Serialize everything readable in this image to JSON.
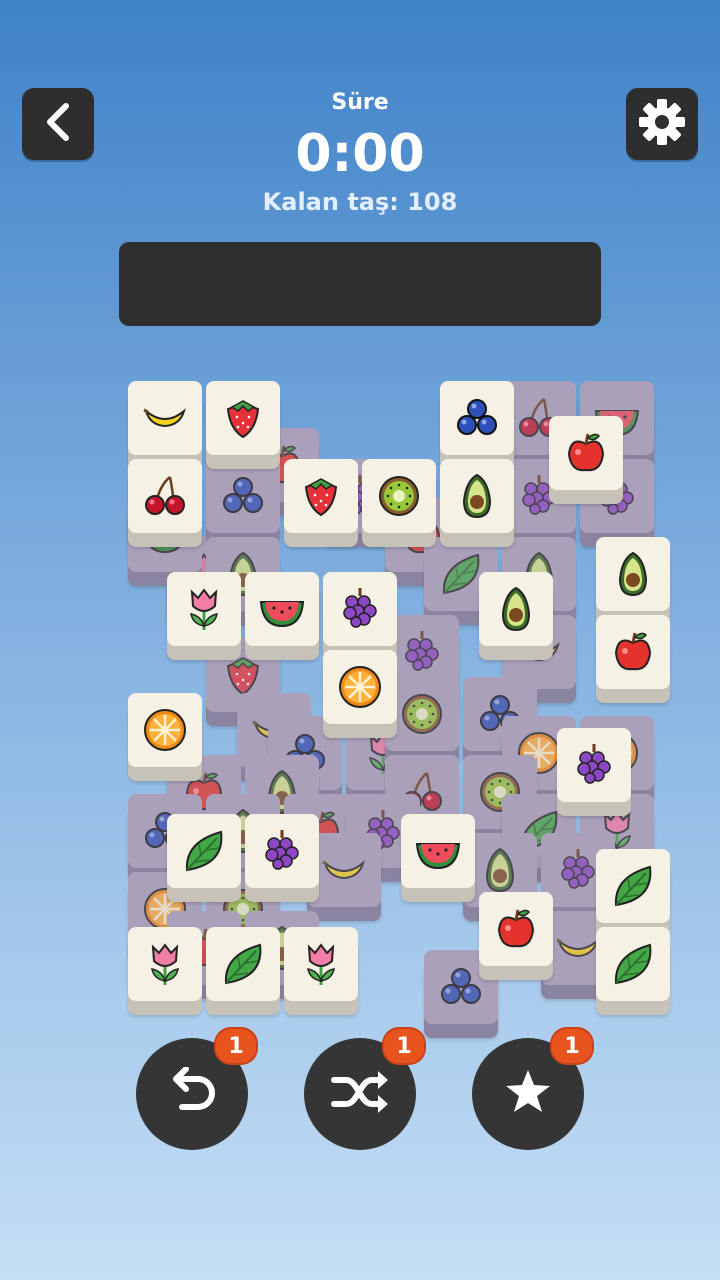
{
  "header": {
    "timer_label": "Süre",
    "timer_value": "0:00",
    "remaining_text": "Kalan taş: 108"
  },
  "icons": {
    "back": "chevron-left-icon",
    "settings": "gear-icon",
    "undo": "undo-arrow-icon",
    "shuffle": "shuffle-icon",
    "hint": "star-icon"
  },
  "powerups": {
    "undo_count": "1",
    "shuffle_count": "1",
    "hint_count": "1"
  },
  "colors": {
    "button_dark": "#2e2e2e",
    "badge": "#e8541e",
    "tile_face": "#f5f1e4",
    "tile_blocked": "#aaa0ba"
  },
  "board": {
    "tiles": [
      {
        "fruit": "tulip",
        "row": 2,
        "col": 1,
        "state": "blocked"
      },
      {
        "fruit": "apple",
        "row": 0.6,
        "col": 2,
        "state": "blocked"
      },
      {
        "fruit": "blueberry",
        "row": 1,
        "col": 1.5,
        "state": "blocked"
      },
      {
        "fruit": "grapes",
        "row": 1,
        "col": 3,
        "state": "blocked"
      },
      {
        "fruit": "avocado",
        "row": 2,
        "col": 1.5,
        "state": "blocked"
      },
      {
        "fruit": "watermelon",
        "row": 1.5,
        "col": 0.5,
        "state": "blocked"
      },
      {
        "fruit": "cherry",
        "row": 0,
        "col": 5.3,
        "state": "blocked"
      },
      {
        "fruit": "watermelon",
        "row": 0,
        "col": 6.3,
        "state": "blocked"
      },
      {
        "fruit": "grapes",
        "row": 1,
        "col": 6.3,
        "state": "blocked"
      },
      {
        "fruit": "grapes",
        "row": 1,
        "col": 5.3,
        "state": "blocked"
      },
      {
        "fruit": "apple",
        "row": 1.5,
        "col": 3.8,
        "state": "blocked"
      },
      {
        "fruit": "leaf",
        "row": 2,
        "col": 4.3,
        "state": "blocked"
      },
      {
        "fruit": "avocado",
        "row": 2,
        "col": 5.3,
        "state": "blocked"
      },
      {
        "fruit": "grapes",
        "row": 3,
        "col": 3.8,
        "state": "blocked"
      },
      {
        "fruit": "banana",
        "row": 3,
        "col": 5.3,
        "state": "blocked"
      },
      {
        "fruit": "strawberry",
        "row": 3.3,
        "col": 1.5,
        "state": "blocked"
      },
      {
        "fruit": "banana",
        "row": 4,
        "col": 1.9,
        "state": "blocked"
      },
      {
        "fruit": "blueberry",
        "row": 4.3,
        "col": 2.3,
        "state": "blocked"
      },
      {
        "fruit": "tulip",
        "row": 4.3,
        "col": 3.3,
        "state": "blocked"
      },
      {
        "fruit": "kiwi",
        "row": 3.8,
        "col": 3.8,
        "state": "blocked"
      },
      {
        "fruit": "blueberry",
        "row": 3.8,
        "col": 4.8,
        "state": "blocked"
      },
      {
        "fruit": "orange",
        "row": 4.3,
        "col": 5.3,
        "state": "blocked"
      },
      {
        "fruit": "orange",
        "row": 4.3,
        "col": 6.3,
        "state": "blocked"
      },
      {
        "fruit": "apple",
        "row": 4.8,
        "col": 1,
        "state": "blocked"
      },
      {
        "fruit": "avocado",
        "row": 4.8,
        "col": 2,
        "state": "blocked"
      },
      {
        "fruit": "cherry",
        "row": 4.8,
        "col": 3.8,
        "state": "blocked"
      },
      {
        "fruit": "kiwi",
        "row": 4.8,
        "col": 4.8,
        "state": "blocked"
      },
      {
        "fruit": "blueberry",
        "row": 5.3,
        "col": 0.5,
        "state": "blocked"
      },
      {
        "fruit": "avocado",
        "row": 5.3,
        "col": 1.5,
        "state": "blocked"
      },
      {
        "fruit": "apple",
        "row": 5.3,
        "col": 2.5,
        "state": "blocked"
      },
      {
        "fruit": "grapes",
        "row": 5.3,
        "col": 3.3,
        "state": "blocked"
      },
      {
        "fruit": "leaf",
        "row": 5.3,
        "col": 5.3,
        "state": "blocked"
      },
      {
        "fruit": "tulip",
        "row": 5.3,
        "col": 6.3,
        "state": "blocked"
      },
      {
        "fruit": "banana",
        "row": 5.8,
        "col": 2.8,
        "state": "blocked"
      },
      {
        "fruit": "avocado",
        "row": 5.8,
        "col": 4.8,
        "state": "blocked"
      },
      {
        "fruit": "grapes",
        "row": 5.8,
        "col": 5.8,
        "state": "blocked"
      },
      {
        "fruit": "orange",
        "row": 6.3,
        "col": 0.5,
        "state": "blocked"
      },
      {
        "fruit": "kiwi",
        "row": 6.3,
        "col": 1.5,
        "state": "blocked"
      },
      {
        "fruit": "apple",
        "row": 6.8,
        "col": 1,
        "state": "blocked"
      },
      {
        "fruit": "avocado",
        "row": 6.8,
        "col": 2,
        "state": "blocked"
      },
      {
        "fruit": "banana",
        "row": 6.8,
        "col": 5.8,
        "state": "blocked"
      },
      {
        "fruit": "blueberry",
        "row": 7.3,
        "col": 4.3,
        "state": "blocked"
      },
      {
        "fruit": "banana",
        "row": 0,
        "col": 0.5,
        "state": "free"
      },
      {
        "fruit": "strawberry",
        "row": 0,
        "col": 1.5,
        "state": "free"
      },
      {
        "fruit": "blueberry",
        "row": 0,
        "col": 4.5,
        "state": "free"
      },
      {
        "fruit": "apple",
        "row": 0.45,
        "col": 5.9,
        "state": "free"
      },
      {
        "fruit": "cherry",
        "row": 1,
        "col": 0.5,
        "state": "free"
      },
      {
        "fruit": "strawberry",
        "row": 1,
        "col": 2.5,
        "state": "free"
      },
      {
        "fruit": "kiwi",
        "row": 1,
        "col": 3.5,
        "state": "free"
      },
      {
        "fruit": "avocado",
        "row": 1,
        "col": 4.5,
        "state": "free"
      },
      {
        "fruit": "avocado",
        "row": 2,
        "col": 6.5,
        "state": "free"
      },
      {
        "fruit": "tulip",
        "row": 2.45,
        "col": 1,
        "state": "free"
      },
      {
        "fruit": "watermelon",
        "row": 2.45,
        "col": 2,
        "state": "free"
      },
      {
        "fruit": "grapes",
        "row": 2.45,
        "col": 3,
        "state": "free"
      },
      {
        "fruit": "avocado",
        "row": 2.45,
        "col": 5,
        "state": "free"
      },
      {
        "fruit": "apple",
        "row": 3,
        "col": 6.5,
        "state": "free"
      },
      {
        "fruit": "orange",
        "row": 3.45,
        "col": 3,
        "state": "free"
      },
      {
        "fruit": "orange",
        "row": 4,
        "col": 0.5,
        "state": "free"
      },
      {
        "fruit": "grapes",
        "row": 4.45,
        "col": 6,
        "state": "free"
      },
      {
        "fruit": "leaf",
        "row": 5.55,
        "col": 1,
        "state": "free"
      },
      {
        "fruit": "grapes",
        "row": 5.55,
        "col": 2,
        "state": "free"
      },
      {
        "fruit": "watermelon",
        "row": 5.55,
        "col": 4,
        "state": "free"
      },
      {
        "fruit": "leaf",
        "row": 6,
        "col": 6.5,
        "state": "free"
      },
      {
        "fruit": "apple",
        "row": 6.55,
        "col": 5,
        "state": "free"
      },
      {
        "fruit": "tulip",
        "row": 7,
        "col": 0.5,
        "state": "free"
      },
      {
        "fruit": "leaf",
        "row": 7,
        "col": 1.5,
        "state": "free"
      },
      {
        "fruit": "tulip",
        "row": 7,
        "col": 2.5,
        "state": "free"
      },
      {
        "fruit": "leaf",
        "row": 7,
        "col": 6.5,
        "state": "free"
      }
    ]
  }
}
